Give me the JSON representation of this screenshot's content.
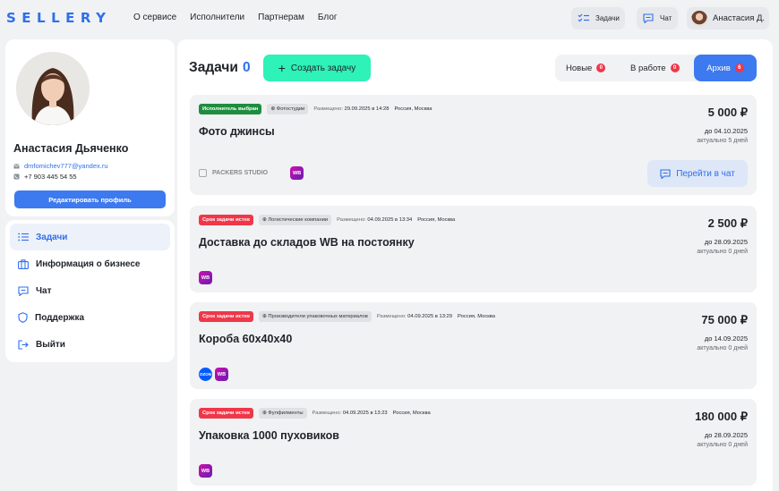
{
  "header": {
    "logo": "SELLERY",
    "nav": [
      "О сервисе",
      "Исполнители",
      "Партнерам",
      "Блог"
    ],
    "tasks_label": "Задачи",
    "chat_label": "Чат",
    "user_name": "Анастасия Д."
  },
  "profile": {
    "name": "Анастасия Дьяченко",
    "email": "dmfomichev777@yandex.ru",
    "phone": "+7 903 445 54 55",
    "edit_label": "Редактировать профиль"
  },
  "menu": [
    {
      "label": "Задачи",
      "icon": "list-icon",
      "active": true
    },
    {
      "label": "Информация о бизнесе",
      "icon": "briefcase-icon",
      "active": false
    },
    {
      "label": "Чат",
      "icon": "chat-icon",
      "active": false
    },
    {
      "label": "Поддержка",
      "icon": "shield-icon",
      "active": false
    },
    {
      "label": "Выйти",
      "icon": "logout-icon",
      "active": false
    }
  ],
  "main": {
    "title": "Задачи",
    "count": "0",
    "create_label": "Создать задачу",
    "tabs": [
      {
        "label": "Новые",
        "badge": "0"
      },
      {
        "label": "В работе",
        "badge": "0"
      },
      {
        "label": "Архив",
        "badge": "6"
      }
    ]
  },
  "tasks": [
    {
      "status": "Исполнитель выбран",
      "status_color": "#1e8e3e",
      "category": "Фотостудии",
      "placed_label": "Размещено:",
      "placed_date": "29.09.2025 в 14:28",
      "location": "Россия, Москва",
      "title": "Фото джинсы",
      "price": "5 000 ₽",
      "due": "до 04.10.2025",
      "actual": "актуально 5 дней",
      "company": "PACKERS STUDIO",
      "marketplaces": [
        "WB"
      ],
      "chat_label": "Перейти в чат"
    },
    {
      "status": "Срок задачи истек",
      "status_color": "#f0374a",
      "category": "Логистические компании",
      "placed_label": "Размещено:",
      "placed_date": "04.09.2025 в 13:34",
      "location": "Россия, Москва",
      "title": "Доставка до складов WB на постоянку",
      "price": "2 500 ₽",
      "due": "до 28.09.2025",
      "actual": "актуально 0 дней",
      "marketplaces": [
        "WB"
      ]
    },
    {
      "status": "Срок задачи истек",
      "status_color": "#f0374a",
      "category": "Производители упаковочных материалов",
      "placed_label": "Размещено:",
      "placed_date": "04.09.2025 в 13:29",
      "location": "Россия, Москва",
      "title": "Короба 60х40х40",
      "price": "75 000 ₽",
      "due": "до 14.09.2025",
      "actual": "актуально 0 дней",
      "marketplaces": [
        "OZON",
        "WB"
      ]
    },
    {
      "status": "Срок задачи истек",
      "status_color": "#f0374a",
      "category": "Фулфилменты",
      "placed_label": "Размещено:",
      "placed_date": "04.09.2025 в 13:23",
      "location": "Россия, Москва",
      "title": "Упаковка 1000 пуховиков",
      "price": "180 000 ₽",
      "due": "до 28.09.2025",
      "actual": "актуально 0 дней",
      "marketplaces": [
        "WB"
      ]
    }
  ],
  "colors": {
    "accent": "#2f6fed",
    "create_button": "#2ef2b8",
    "badge_red": "#f0374a",
    "wb_purple": "#cb11ab",
    "ozon_blue": "#005bff"
  }
}
